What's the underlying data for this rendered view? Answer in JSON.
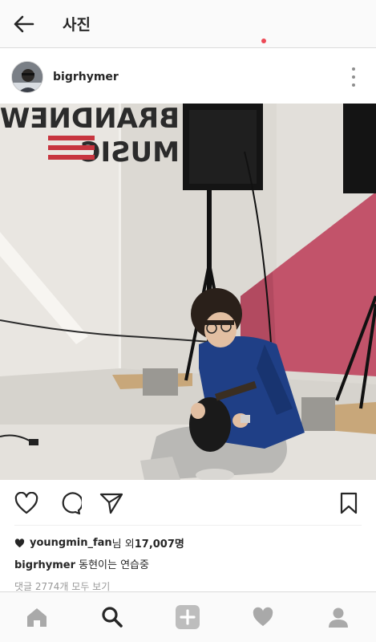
{
  "header": {
    "title": "사진",
    "back_icon": "arrow-left-icon"
  },
  "post": {
    "username": "bigrhymer",
    "photo_sign_text": {
      "line1": "BRANDNEW",
      "line2": "MUSIC"
    },
    "likes": {
      "first_liker": "youngmin_fan",
      "suffix": "님 외 ",
      "count": "17,007명"
    },
    "caption": {
      "username": "bigrhymer",
      "text": " 동현이는 연습중"
    },
    "comments_link": "댓글 2774개 모두 보기"
  },
  "colors": {
    "accent_notification": "#ed4956",
    "icon_active": "#262626",
    "icon_inactive": "#a9a9a9",
    "wall_red": "#c2536a"
  },
  "icons": {
    "actions": [
      "heart-outline-icon",
      "comment-icon",
      "send-icon",
      "bookmark-icon"
    ],
    "tabs": [
      "home-icon",
      "search-icon",
      "add-post-icon",
      "activity-heart-icon",
      "profile-icon"
    ]
  }
}
